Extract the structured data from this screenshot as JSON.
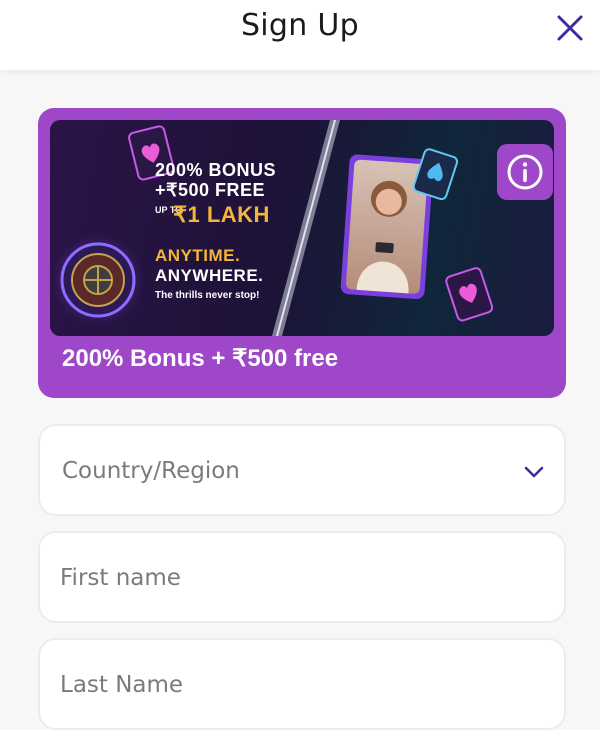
{
  "header": {
    "title": "Sign Up",
    "close_icon": "close-icon"
  },
  "promo": {
    "banner": {
      "line1": "200% BONUS",
      "line2": "+₹500 FREE",
      "up_to": "UP TO",
      "line3": "₹1 LAKH",
      "line4": "ANYTIME.",
      "line5": "ANYWHERE.",
      "tagline": "The thrills never stop!"
    },
    "caption": "200% Bonus + ₹500 free",
    "info_icon": "info-icon"
  },
  "form": {
    "country": {
      "placeholder": "Country/Region",
      "icon": "chevron-down-icon"
    },
    "first_name": {
      "placeholder": "First name",
      "value": ""
    },
    "last_name": {
      "placeholder": "Last Name",
      "value": ""
    }
  },
  "colors": {
    "accent": "#9e47c9",
    "icon_color": "#3b2d9e",
    "gold": "#f4b63a"
  }
}
